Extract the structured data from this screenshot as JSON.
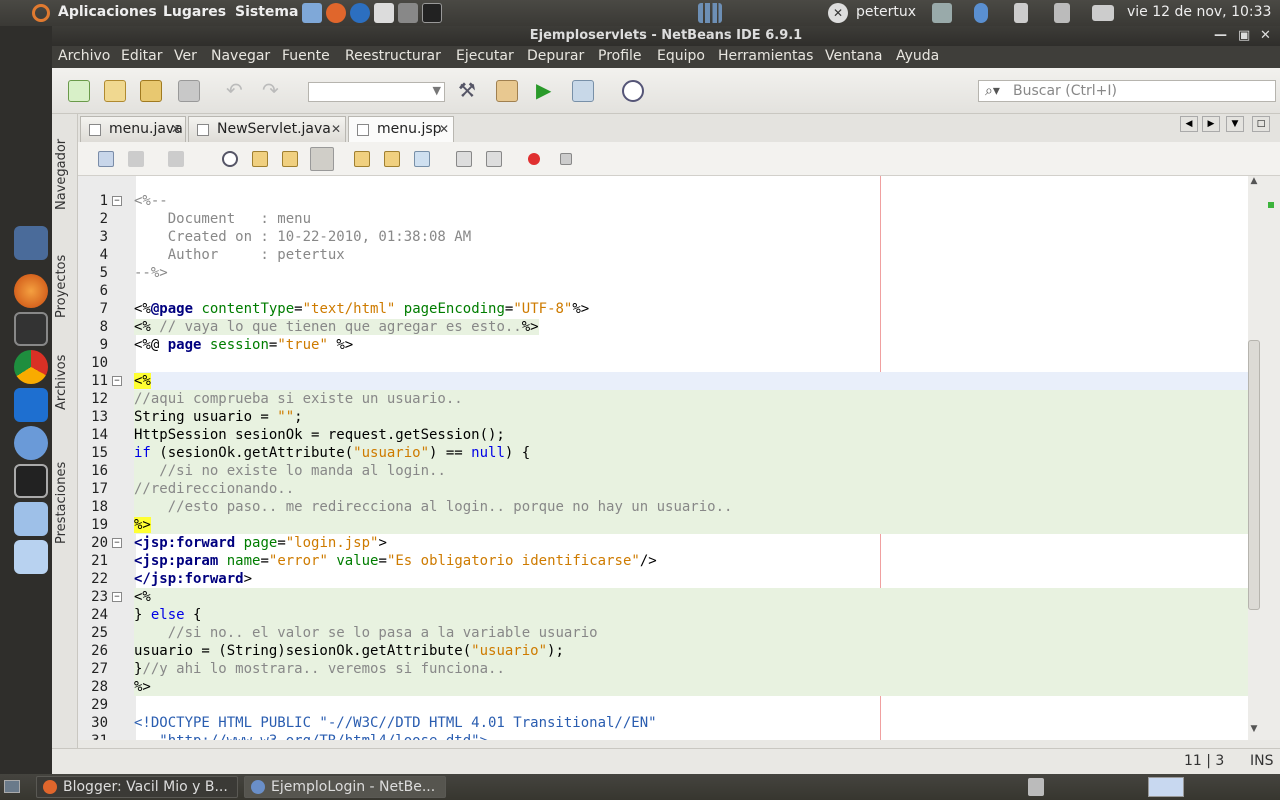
{
  "top_panel": {
    "apps_label": "Aplicaciones",
    "places_label": "Lugares",
    "system_label": "Sistema",
    "user": "petertux",
    "clock": "vie 12 de nov, 10:33"
  },
  "window": {
    "title": "Ejemploservlets - NetBeans IDE 6.9.1"
  },
  "menubar": [
    "Archivo",
    "Editar",
    "Ver",
    "Navegar",
    "Fuente",
    "Reestructurar",
    "Ejecutar",
    "Depurar",
    "Profile",
    "Equipo",
    "Herramientas",
    "Ventana",
    "Ayuda"
  ],
  "search": {
    "placeholder": "Buscar (Ctrl+I)"
  },
  "side_tabs": [
    "Navegador",
    "Proyectos",
    "Archivos",
    "Prestaciones"
  ],
  "editor_tabs": [
    {
      "label": "menu.java",
      "close": "✕"
    },
    {
      "label": "NewServlet.java",
      "close": "✕"
    },
    {
      "label": "menu.jsp",
      "close": "✕"
    }
  ],
  "code_lines": [
    {
      "n": "1",
      "fold": "−",
      "html": "<span class=\"c-com\">&lt;%--</span>"
    },
    {
      "n": "2",
      "html": "<span class=\"c-com\">    Document   : menu</span>"
    },
    {
      "n": "3",
      "html": "<span class=\"c-com\">    Created on : 10-22-2010, 01:38:08 AM</span>"
    },
    {
      "n": "4",
      "html": "<span class=\"c-com\">    Author     : petertux</span>"
    },
    {
      "n": "5",
      "html": "<span class=\"c-com\">--%&gt;</span>"
    },
    {
      "n": "6",
      "html": ""
    },
    {
      "n": "7",
      "html": "&lt;%<span class=\"c-dir\">@page</span> <span class=\"c-attr\">contentType</span>=<span class=\"c-str\">\"text/html\"</span> <span class=\"c-attr\">pageEncoding</span>=<span class=\"c-str\">\"UTF-8\"</span>%&gt;"
    },
    {
      "n": "8",
      "cls": "jsp8",
      "html": "&lt;% <span class=\"c-com\">// vaya lo que tienen que agregar es esto..</span>%&gt;"
    },
    {
      "n": "9",
      "html": "&lt;%@ <span class=\"c-dir\">page</span> <span class=\"c-attr\">session</span>=<span class=\"c-str\">\"true\"</span> %&gt;"
    },
    {
      "n": "10",
      "html": ""
    },
    {
      "n": "11",
      "fold": "−",
      "cls": "cur",
      "html": "<span class=\"c-hl\">&lt;%</span>"
    },
    {
      "n": "12",
      "cls": "jsp",
      "html": "<span class=\"c-com\">//aqui comprueba si existe un usuario..</span>"
    },
    {
      "n": "13",
      "cls": "jsp",
      "html": "String usuario = <span class=\"c-str\">\"\"</span>;"
    },
    {
      "n": "14",
      "cls": "jsp",
      "html": "HttpSession sesionOk = request.getSession();"
    },
    {
      "n": "15",
      "cls": "jsp",
      "html": "<span class=\"c-kw\">if</span> (sesionOk.getAttribute(<span class=\"c-str\">\"usuario\"</span>) == <span class=\"c-kw\">null</span>) {"
    },
    {
      "n": "16",
      "cls": "jsp",
      "html": "   <span class=\"c-com\">//si no existe lo manda al login..</span>"
    },
    {
      "n": "17",
      "cls": "jsp",
      "html": "<span class=\"c-com\">//redireccionando..</span>"
    },
    {
      "n": "18",
      "cls": "jsp",
      "html": "    <span class=\"c-com\">//esto paso.. me redirecciona al login.. porque no hay un usuario..</span>"
    },
    {
      "n": "19",
      "cls": "jsp",
      "html": "<span class=\"c-hl\">%&gt;</span>"
    },
    {
      "n": "20",
      "fold": "−",
      "html": "<span class=\"c-tag\">&lt;jsp:forward</span> <span class=\"c-attr\">page</span>=<span class=\"c-str\">\"login.jsp\"</span>&gt;"
    },
    {
      "n": "21",
      "html": "<span class=\"c-tag\">&lt;jsp:param</span> <span class=\"c-attr\">name</span>=<span class=\"c-str\">\"error\"</span> <span class=\"c-attr\">value</span>=<span class=\"c-str\">\"Es obligatorio identificarse\"</span>/&gt;"
    },
    {
      "n": "22",
      "html": "<span class=\"c-tag\">&lt;/jsp:forward</span>&gt;"
    },
    {
      "n": "23",
      "fold": "−",
      "cls": "jsp",
      "html": "&lt;%"
    },
    {
      "n": "24",
      "cls": "jsp",
      "html": "} <span class=\"c-kw\">else</span> {"
    },
    {
      "n": "25",
      "cls": "jsp",
      "html": "    <span class=\"c-com\">//si no.. el valor se lo pasa a la variable usuario</span>"
    },
    {
      "n": "26",
      "cls": "jsp",
      "html": "usuario = (String)sesionOk.getAttribute(<span class=\"c-str\">\"usuario\"</span>);"
    },
    {
      "n": "27",
      "cls": "jsp",
      "html": "}<span class=\"c-com\">//y ahi lo mostrara.. veremos si funciona..</span>"
    },
    {
      "n": "28",
      "cls": "jsp",
      "html": "%&gt;"
    },
    {
      "n": "29",
      "html": ""
    },
    {
      "n": "30",
      "html": "<span class=\"c-com\" style=\"color:#2a5db0\">&lt;!DOCTYPE HTML PUBLIC \"-//W3C//DTD HTML 4.01 Transitional//EN\"</span>"
    },
    {
      "n": "31",
      "html": "<span class=\"c-com\" style=\"color:#2a5db0\">   \"http://www.w3.org/TR/html4/loose.dtd\"&gt;</span>"
    }
  ],
  "status": {
    "position": "11 | 3",
    "mode": "INS"
  },
  "taskbar": [
    {
      "label": "Blogger: Vacil Mio y B...",
      "color": "#e0662c"
    },
    {
      "label": "EjemploLogin - NetBe...",
      "color": "#6a8fc9"
    }
  ]
}
